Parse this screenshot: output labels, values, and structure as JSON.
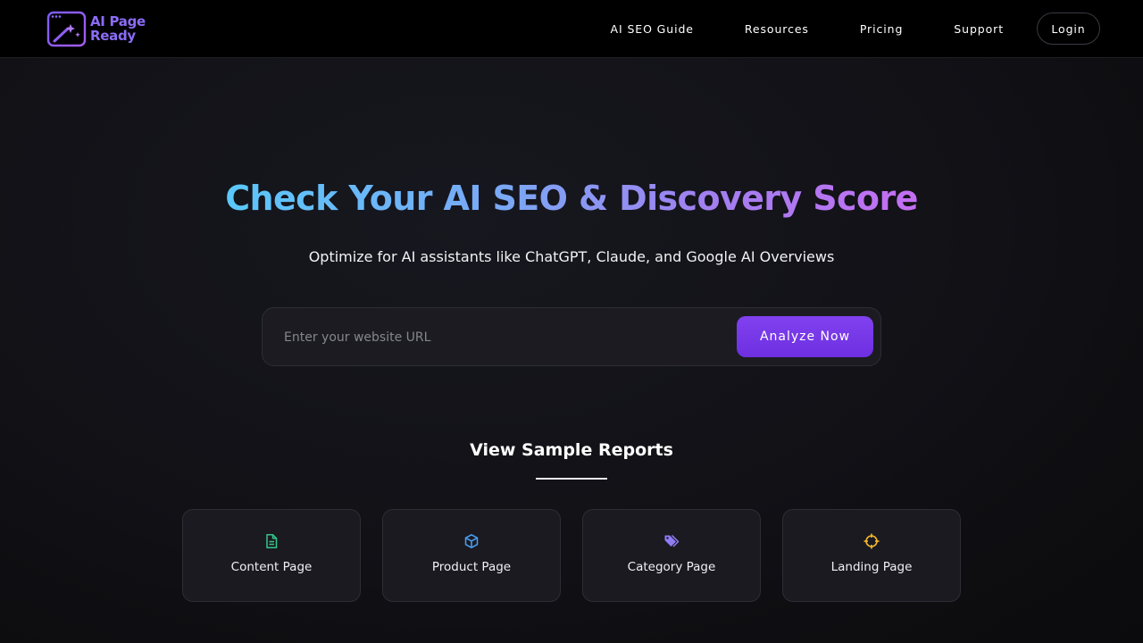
{
  "brand": {
    "line1": "AI Page",
    "line2": "Ready",
    "color": "#8b6cf6"
  },
  "nav": {
    "links": [
      {
        "label": "AI SEO Guide"
      },
      {
        "label": "Resources"
      },
      {
        "label": "Pricing"
      },
      {
        "label": "Support"
      }
    ],
    "login_label": "Login"
  },
  "hero": {
    "title": "Check Your AI SEO & Discovery Score",
    "subtitle": "Optimize for AI assistants like ChatGPT, Claude, and Google AI Overviews",
    "gradient": [
      "#5ac8fa",
      "#c46ef2"
    ]
  },
  "search": {
    "placeholder": "Enter your website URL",
    "value": "",
    "button_label": "Analyze Now",
    "button_color": "#7a3cf0"
  },
  "samples": {
    "title": "View Sample Reports",
    "cards": [
      {
        "label": "Content Page",
        "icon": "document-icon",
        "color": "#34c48a"
      },
      {
        "label": "Product Page",
        "icon": "cube-icon",
        "color": "#4a9ff5"
      },
      {
        "label": "Category Page",
        "icon": "tags-icon",
        "color": "#8f7cf5"
      },
      {
        "label": "Landing Page",
        "icon": "crosshair-icon",
        "color": "#f5b82e"
      }
    ]
  }
}
